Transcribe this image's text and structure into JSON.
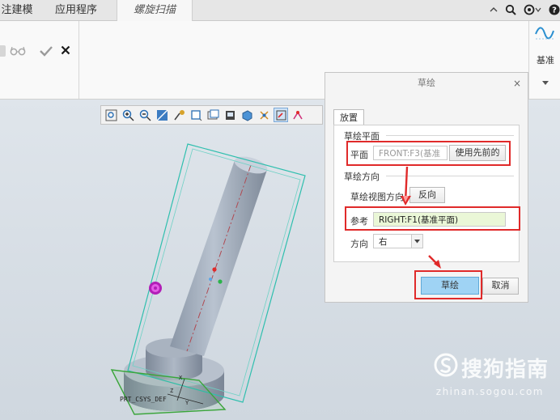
{
  "tabs": [
    {
      "label": "注建模",
      "active": false
    },
    {
      "label": "应用程序",
      "active": false
    },
    {
      "label": "螺旋扫描",
      "active": true
    }
  ],
  "ribbon": {
    "base_label": "基准"
  },
  "model": {
    "csys_label": "PRT_CSYS_DEF",
    "axis_labels": [
      "X",
      "Y",
      "Z"
    ]
  },
  "dialog": {
    "title": "草绘",
    "close_glyph": "×",
    "tab_label": "放置",
    "plane_group_label": "草绘平面",
    "plane_label": "平面",
    "plane_value": "FRONT:F3(基准",
    "use_previous_label": "使用先前的",
    "direction_group_label": "草绘方向",
    "view_direction_label": "草绘视图方向",
    "flip_label": "反向",
    "reference_label": "参考",
    "reference_value": "RIGHT:F1(基准平面)",
    "orientation_label": "方向",
    "orientation_value": "右",
    "ok_label": "草绘",
    "cancel_label": "取消"
  },
  "watermark": {
    "brand": "搜狗指南",
    "url": "zhinan.sogou.com"
  },
  "colors": {
    "accent_red": "#e02a2a",
    "field_green": "#eaf7d7",
    "ok_blue": "#9fd3f4",
    "frame_teal": "#2fbfae",
    "plane_green": "#3aa53a"
  }
}
